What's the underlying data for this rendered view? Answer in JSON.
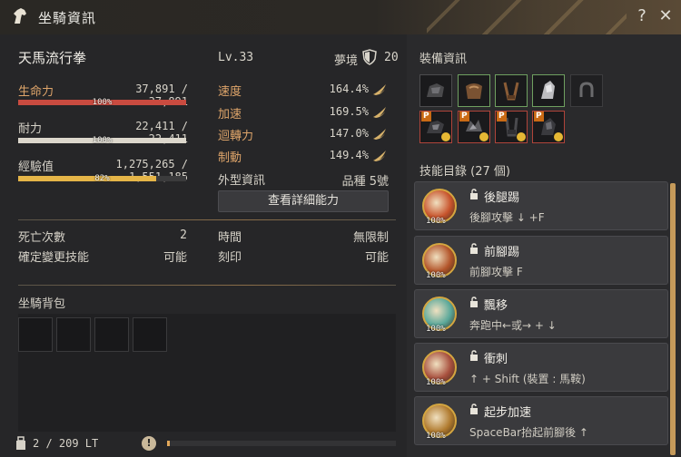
{
  "window": {
    "title": "坐騎資訊"
  },
  "mount": {
    "name": "天馬流行拳",
    "level": "Lv.33",
    "dream_label": "夢境",
    "dream_value": "20"
  },
  "stats": [
    {
      "label": "生命力",
      "value": "37,891 / 37,891",
      "percent": "100%",
      "fill": 1.0,
      "color": "#c94b40"
    },
    {
      "label": "耐力",
      "value": "22,411 / 22,411",
      "percent": "100%",
      "fill": 1.0,
      "color": "#dcd7cc"
    },
    {
      "label": "經驗值",
      "value": "1,275,265 / 1,551,185",
      "percent": "82%",
      "fill": 0.822,
      "color": "#e5b548"
    }
  ],
  "speed_stats": [
    {
      "label": "速度",
      "value": "164.4%"
    },
    {
      "label": "加速",
      "value": "169.5%"
    },
    {
      "label": "迴轉力",
      "value": "147.0%"
    },
    {
      "label": "制動",
      "value": "149.4%"
    }
  ],
  "appearance": {
    "label": "外型資訊",
    "value": "品種 5號"
  },
  "detail_button": "查看詳細能力",
  "info_rows": {
    "death_label": "死亡次數",
    "death_value": "2",
    "skill_change_label": "確定變更技能",
    "skill_change_value": "可能",
    "time_label": "時間",
    "time_value": "無限制",
    "engrave_label": "刻印",
    "engrave_value": "可能"
  },
  "bag": {
    "title": "坐騎背包",
    "weight_text": "2 / 209 LT",
    "weight_fill": 0.01
  },
  "equipment": {
    "title": "裝備資訊",
    "row1": [
      {
        "name": "horse-armor-icon",
        "border": "gray"
      },
      {
        "name": "horse-saddle-icon",
        "border": "green"
      },
      {
        "name": "horse-stirrup-icon",
        "border": "green"
      },
      {
        "name": "horse-helm-icon",
        "border": "green"
      },
      {
        "name": "horseshoe-icon",
        "border": "empty"
      }
    ],
    "row2": [
      {
        "name": "premium-armor-icon",
        "border": "red",
        "tag": "P"
      },
      {
        "name": "premium-saddle-icon",
        "border": "red",
        "tag": "P"
      },
      {
        "name": "premium-stirrup-icon",
        "border": "red",
        "tag": "P"
      },
      {
        "name": "premium-helm-icon",
        "border": "red",
        "tag": "P"
      }
    ]
  },
  "skills": {
    "title": "技能目錄 (27 個)",
    "items": [
      {
        "name": "後腿踢",
        "command": "後腳攻擊 ↓ +F",
        "percent": "100%",
        "icon": "back-kick-icon",
        "color": "#c8542c"
      },
      {
        "name": "前腳踢",
        "command": "前腳攻擊 F",
        "percent": "100%",
        "icon": "front-kick-icon",
        "color": "#b3552a"
      },
      {
        "name": "飄移",
        "command": "奔跑中←或→ + ↓",
        "percent": "100%",
        "icon": "drift-icon",
        "color": "#5aa89a"
      },
      {
        "name": "衝刺",
        "command": "↑ + Shift (裝置 : 馬鞍)",
        "percent": "100%",
        "icon": "sprint-icon",
        "color": "#a8503e"
      },
      {
        "name": "起步加速",
        "command": "SpaceBar抬起前腳後 ↑",
        "percent": "100%",
        "icon": "start-accel-icon",
        "color": "#b07a2e"
      }
    ]
  }
}
